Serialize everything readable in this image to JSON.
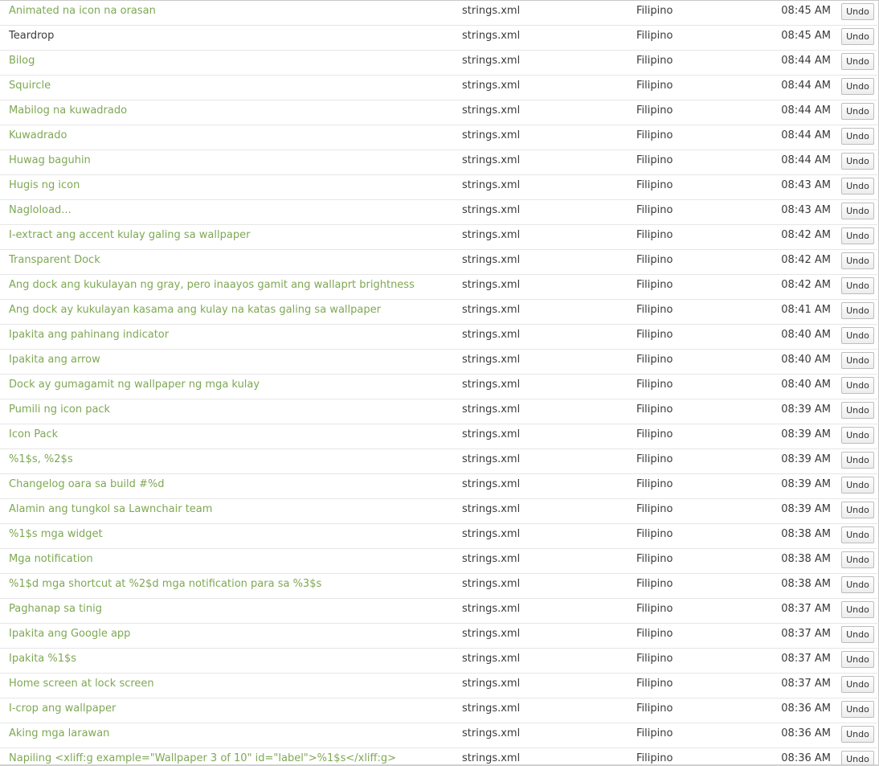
{
  "rows": [
    {
      "string": "Animated na icon na orasan",
      "file": "strings.xml",
      "language": "Filipino",
      "time": "08:45 AM",
      "undo_label": "Undo"
    },
    {
      "string": "Teardrop",
      "file": "strings.xml",
      "language": "Filipino",
      "time": "08:45 AM",
      "undo_label": "Undo"
    },
    {
      "string": "Bilog",
      "file": "strings.xml",
      "language": "Filipino",
      "time": "08:44 AM",
      "undo_label": "Undo"
    },
    {
      "string": "Squircle",
      "file": "strings.xml",
      "language": "Filipino",
      "time": "08:44 AM",
      "undo_label": "Undo"
    },
    {
      "string": "Mabilog na kuwadrado",
      "file": "strings.xml",
      "language": "Filipino",
      "time": "08:44 AM",
      "undo_label": "Undo"
    },
    {
      "string": "Kuwadrado",
      "file": "strings.xml",
      "language": "Filipino",
      "time": "08:44 AM",
      "undo_label": "Undo"
    },
    {
      "string": "Huwag baguhin",
      "file": "strings.xml",
      "language": "Filipino",
      "time": "08:44 AM",
      "undo_label": "Undo"
    },
    {
      "string": "Hugis ng icon",
      "file": "strings.xml",
      "language": "Filipino",
      "time": "08:43 AM",
      "undo_label": "Undo"
    },
    {
      "string": "Nagloload...",
      "file": "strings.xml",
      "language": "Filipino",
      "time": "08:43 AM",
      "undo_label": "Undo"
    },
    {
      "string": "I-extract ang accent kulay galing sa wallpaper",
      "file": "strings.xml",
      "language": "Filipino",
      "time": "08:42 AM",
      "undo_label": "Undo"
    },
    {
      "string": "Transparent Dock",
      "file": "strings.xml",
      "language": "Filipino",
      "time": "08:42 AM",
      "undo_label": "Undo"
    },
    {
      "string": "Ang dock ang kukulayan ng gray, pero inaayos gamit ang wallaprt brightness",
      "file": "strings.xml",
      "language": "Filipino",
      "time": "08:42 AM",
      "undo_label": "Undo"
    },
    {
      "string": "Ang dock ay kukulayan kasama ang kulay na katas galing sa wallpaper",
      "file": "strings.xml",
      "language": "Filipino",
      "time": "08:41 AM",
      "undo_label": "Undo"
    },
    {
      "string": "Ipakita ang pahinang indicator",
      "file": "strings.xml",
      "language": "Filipino",
      "time": "08:40 AM",
      "undo_label": "Undo"
    },
    {
      "string": "Ipakita ang arrow",
      "file": "strings.xml",
      "language": "Filipino",
      "time": "08:40 AM",
      "undo_label": "Undo"
    },
    {
      "string": "Dock ay gumagamit ng wallpaper ng mga kulay",
      "file": "strings.xml",
      "language": "Filipino",
      "time": "08:40 AM",
      "undo_label": "Undo"
    },
    {
      "string": "Pumili ng icon pack",
      "file": "strings.xml",
      "language": "Filipino",
      "time": "08:39 AM",
      "undo_label": "Undo"
    },
    {
      "string": "Icon Pack",
      "file": "strings.xml",
      "language": "Filipino",
      "time": "08:39 AM",
      "undo_label": "Undo"
    },
    {
      "string": "%1$s, %2$s",
      "file": "strings.xml",
      "language": "Filipino",
      "time": "08:39 AM",
      "undo_label": "Undo"
    },
    {
      "string": "Changelog oara sa build #%d",
      "file": "strings.xml",
      "language": "Filipino",
      "time": "08:39 AM",
      "undo_label": "Undo"
    },
    {
      "string": "Alamin ang tungkol sa Lawnchair team",
      "file": "strings.xml",
      "language": "Filipino",
      "time": "08:39 AM",
      "undo_label": "Undo"
    },
    {
      "string": "%1$s mga widget",
      "file": "strings.xml",
      "language": "Filipino",
      "time": "08:38 AM",
      "undo_label": "Undo"
    },
    {
      "string": "Mga notification",
      "file": "strings.xml",
      "language": "Filipino",
      "time": "08:38 AM",
      "undo_label": "Undo"
    },
    {
      "string": "%1$d mga shortcut at %2$d mga notification para sa %3$s",
      "file": "strings.xml",
      "language": "Filipino",
      "time": "08:38 AM",
      "undo_label": "Undo"
    },
    {
      "string": "Paghanap sa tinig",
      "file": "strings.xml",
      "language": "Filipino",
      "time": "08:37 AM",
      "undo_label": "Undo"
    },
    {
      "string": "Ipakita ang Google app",
      "file": "strings.xml",
      "language": "Filipino",
      "time": "08:37 AM",
      "undo_label": "Undo"
    },
    {
      "string": "Ipakita %1$s",
      "file": "strings.xml",
      "language": "Filipino",
      "time": "08:37 AM",
      "undo_label": "Undo"
    },
    {
      "string": "Home screen at lock screen",
      "file": "strings.xml",
      "language": "Filipino",
      "time": "08:37 AM",
      "undo_label": "Undo"
    },
    {
      "string": "I-crop ang wallpaper",
      "file": "strings.xml",
      "language": "Filipino",
      "time": "08:36 AM",
      "undo_label": "Undo"
    },
    {
      "string": "Aking mga larawan",
      "file": "strings.xml",
      "language": "Filipino",
      "time": "08:36 AM",
      "undo_label": "Undo"
    },
    {
      "string": "Napiling <xliff:g example=\"Wallpaper 3 of 10\" id=\"label\">%1$s</xliff:g>",
      "file": "strings.xml",
      "language": "Filipino",
      "time": "08:36 AM",
      "undo_label": "Undo"
    }
  ],
  "colors": {
    "link_green": "#7ea853",
    "text_dark": "#3a3a3a",
    "row_border": "#e6e6e6"
  }
}
